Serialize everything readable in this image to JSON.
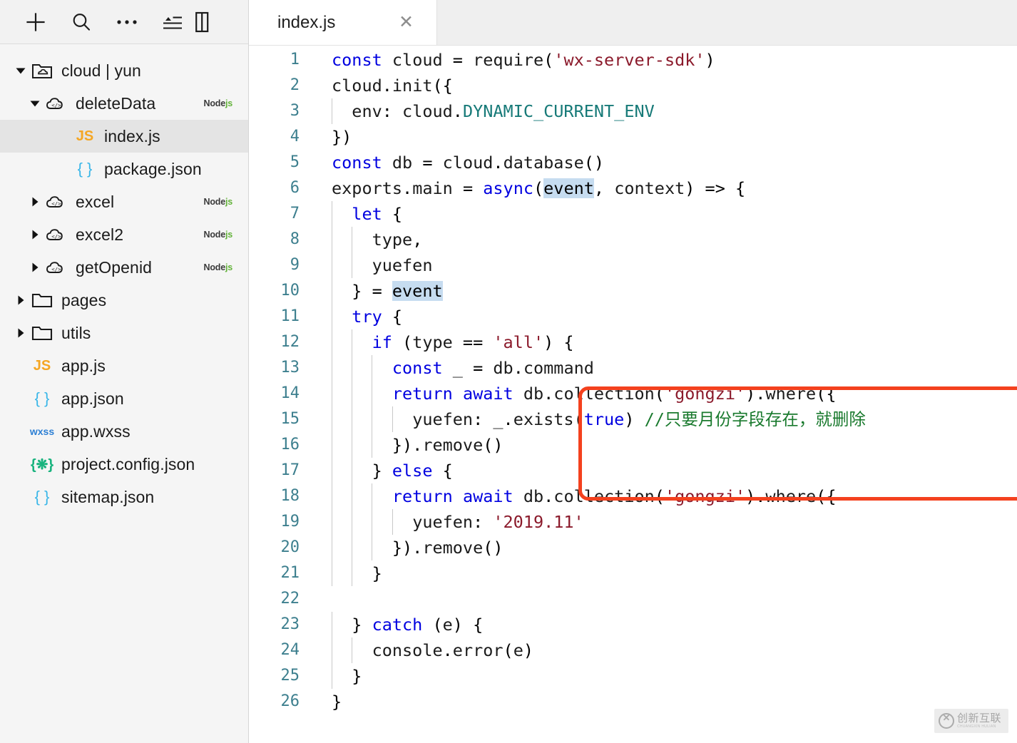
{
  "sidebar": {
    "toolbar": [
      {
        "name": "add-file-icon",
        "title": "新建"
      },
      {
        "name": "search-icon",
        "title": "搜索"
      },
      {
        "name": "more-options-icon",
        "title": "更多"
      },
      {
        "name": "collapse-all-icon",
        "title": "折叠"
      },
      {
        "name": "panel-layout-icon",
        "title": "面板"
      }
    ],
    "tree": [
      {
        "depth": 0,
        "label": "cloud | yun",
        "icon": "cloud-folder-icon",
        "twisty": "down",
        "badge": "",
        "selected": false
      },
      {
        "depth": 1,
        "label": "deleteData",
        "icon": "cloud-function-icon",
        "twisty": "down",
        "badge": "Nodejs",
        "selected": false
      },
      {
        "depth": 2,
        "label": "index.js",
        "icon": "js-file-icon",
        "twisty": "none",
        "badge": "",
        "selected": true
      },
      {
        "depth": 2,
        "label": "package.json",
        "icon": "json-file-icon",
        "twisty": "none",
        "badge": "",
        "selected": false
      },
      {
        "depth": 1,
        "label": "excel",
        "icon": "cloud-function-icon",
        "twisty": "right",
        "badge": "Nodejs",
        "selected": false
      },
      {
        "depth": 1,
        "label": "excel2",
        "icon": "cloud-function-icon",
        "twisty": "right",
        "badge": "Nodejs",
        "selected": false
      },
      {
        "depth": 1,
        "label": "getOpenid",
        "icon": "cloud-function-icon",
        "twisty": "right",
        "badge": "Nodejs",
        "selected": false
      },
      {
        "depth": 0,
        "label": "pages",
        "icon": "folder-icon",
        "twisty": "right",
        "badge": "",
        "selected": false
      },
      {
        "depth": 0,
        "label": "utils",
        "icon": "folder-icon",
        "twisty": "right",
        "badge": "",
        "selected": false
      },
      {
        "depth": 0,
        "label": "app.js",
        "icon": "js-file-icon",
        "twisty": "none",
        "badge": "",
        "selected": false
      },
      {
        "depth": 0,
        "label": "app.json",
        "icon": "json-file-icon",
        "twisty": "none",
        "badge": "",
        "selected": false
      },
      {
        "depth": 0,
        "label": "app.wxss",
        "icon": "wxss-file-icon",
        "twisty": "none",
        "badge": "",
        "selected": false
      },
      {
        "depth": 0,
        "label": "project.config.json",
        "icon": "config-file-icon",
        "twisty": "none",
        "badge": "",
        "selected": false
      },
      {
        "depth": 0,
        "label": "sitemap.json",
        "icon": "json-file-icon",
        "twisty": "none",
        "badge": "",
        "selected": false
      }
    ]
  },
  "editor": {
    "tab": {
      "label": "index.js",
      "close": "✕"
    },
    "code_lines": [
      {
        "n": "1",
        "text": "const cloud = require('wx-server-sdk')"
      },
      {
        "n": "2",
        "text": "cloud.init({"
      },
      {
        "n": "3",
        "text": "  env: cloud.DYNAMIC_CURRENT_ENV"
      },
      {
        "n": "4",
        "text": "})"
      },
      {
        "n": "5",
        "text": "const db = cloud.database()"
      },
      {
        "n": "6",
        "text": "exports.main = async(event, context) => {"
      },
      {
        "n": "7",
        "text": "  let {"
      },
      {
        "n": "8",
        "text": "    type,"
      },
      {
        "n": "9",
        "text": "    yuefen"
      },
      {
        "n": "10",
        "text": "  } = event"
      },
      {
        "n": "11",
        "text": "  try {"
      },
      {
        "n": "12",
        "text": "    if (type == 'all') {"
      },
      {
        "n": "13",
        "text": "      const _ = db.command"
      },
      {
        "n": "14",
        "text": "      return await db.collection('gongzi').where({"
      },
      {
        "n": "15",
        "text": "        yuefen: _.exists(true) //只要月份字段存在，就删除"
      },
      {
        "n": "16",
        "text": "      }).remove()"
      },
      {
        "n": "17",
        "text": "    } else {"
      },
      {
        "n": "18",
        "text": "      return await db.collection('gongzi').where({"
      },
      {
        "n": "19",
        "text": "        yuefen: '2019.11'"
      },
      {
        "n": "20",
        "text": "      }).remove()"
      },
      {
        "n": "21",
        "text": "    }"
      },
      {
        "n": "22",
        "text": ""
      },
      {
        "n": "23",
        "text": "  } catch (e) {"
      },
      {
        "n": "24",
        "text": "    console.error(e)"
      },
      {
        "n": "25",
        "text": "  }"
      },
      {
        "n": "26",
        "text": "}"
      }
    ],
    "highlighted_token": "event",
    "annotation": {
      "shape": "rounded-rectangle",
      "color": "#f4411e",
      "covers_lines": "13-16"
    }
  },
  "watermark": {
    "cn": "创新互联",
    "en": "CHUANGXIN HULIAN"
  },
  "colors": {
    "keyword": "#0000e0",
    "string": "#8b1a2b",
    "comment": "#1a7a2e",
    "constant": "#177a78",
    "line_number": "#3d7f8e",
    "highlight_bg": "#c6dcf0",
    "annotation": "#f4411e",
    "sidebar_bg": "#f5f5f5",
    "selected_row": "#e4e4e4",
    "nodejs_badge_js": "#63b23a"
  }
}
